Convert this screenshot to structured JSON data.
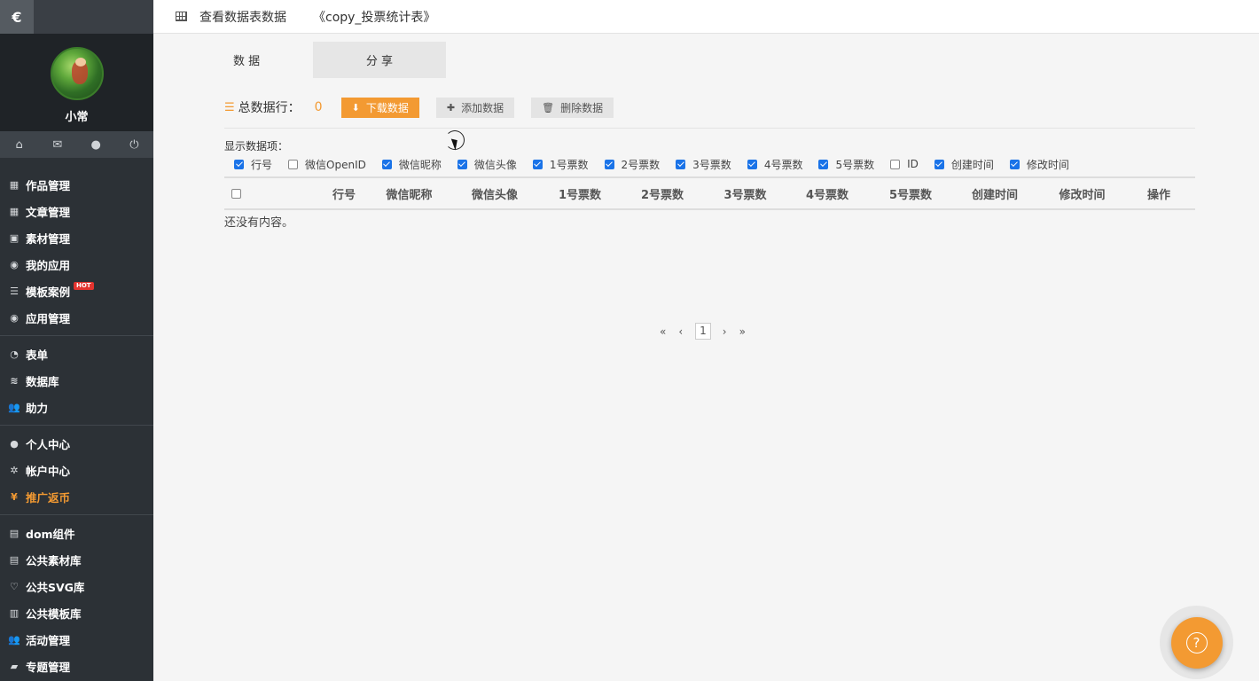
{
  "sidebar": {
    "logo_glyph": "€",
    "username": "小常",
    "quick_icons": [
      "home-icon",
      "mail-icon",
      "user-icon",
      "power-icon"
    ],
    "groups": [
      [
        {
          "label": "作品管理",
          "icon": "grid-icon"
        },
        {
          "label": "文章管理",
          "icon": "grid-icon"
        },
        {
          "label": "素材管理",
          "icon": "image-icon"
        },
        {
          "label": "我的应用",
          "icon": "app-icon"
        },
        {
          "label": "模板案例",
          "icon": "list-icon",
          "badge": "HOT"
        },
        {
          "label": "应用管理",
          "icon": "app-icon"
        }
      ],
      [
        {
          "label": "表单",
          "icon": "pie-icon"
        },
        {
          "label": "数据库",
          "icon": "database-icon"
        },
        {
          "label": "助力",
          "icon": "users-icon"
        }
      ],
      [
        {
          "label": "个人中心",
          "icon": "user-icon"
        },
        {
          "label": "帐户中心",
          "icon": "gear-icon"
        },
        {
          "label": "推广返币",
          "icon": "yen-icon",
          "highlight": true
        }
      ],
      [
        {
          "label": "dom组件",
          "icon": "briefcase-icon"
        },
        {
          "label": "公共素材库",
          "icon": "briefcase-icon"
        },
        {
          "label": "公共SVG库",
          "icon": "heart-icon"
        },
        {
          "label": "公共模板库",
          "icon": "building-icon"
        },
        {
          "label": "活动管理",
          "icon": "users-icon"
        },
        {
          "label": "专题管理",
          "icon": "book-icon"
        }
      ]
    ]
  },
  "header": {
    "title": "查看数据表数据",
    "subtitle": "《copy_投票统计表》"
  },
  "tabs": {
    "data": "数 据",
    "share": "分 享"
  },
  "toolbar": {
    "total_label": "总数据行：",
    "total_count": "0",
    "download": "下载数据",
    "add": "添加数据",
    "delete": "删除数据"
  },
  "fields": {
    "label": "显示数据项：",
    "items": [
      {
        "label": "行号",
        "checked": true
      },
      {
        "label": "微信OpenID",
        "checked": false
      },
      {
        "label": "微信昵称",
        "checked": true
      },
      {
        "label": "微信头像",
        "checked": true
      },
      {
        "label": "1号票数",
        "checked": true
      },
      {
        "label": "2号票数",
        "checked": true
      },
      {
        "label": "3号票数",
        "checked": true
      },
      {
        "label": "4号票数",
        "checked": true
      },
      {
        "label": "5号票数",
        "checked": true
      },
      {
        "label": "ID",
        "checked": false
      },
      {
        "label": "创建时间",
        "checked": true
      },
      {
        "label": "修改时间",
        "checked": true
      }
    ]
  },
  "table": {
    "columns": [
      "行号",
      "微信昵称",
      "微信头像",
      "1号票数",
      "2号票数",
      "3号票数",
      "4号票数",
      "5号票数",
      "创建时间",
      "修改时间",
      "操作"
    ],
    "empty": "还没有内容。"
  },
  "pagination": {
    "first": "«",
    "prev": "‹",
    "current": "1",
    "next": "›",
    "last": "»"
  },
  "colors": {
    "accent": "#f39a32",
    "sidebar_bg": "#2c3136",
    "checkbox": "#1a73e8"
  },
  "help_icon": "question-icon"
}
